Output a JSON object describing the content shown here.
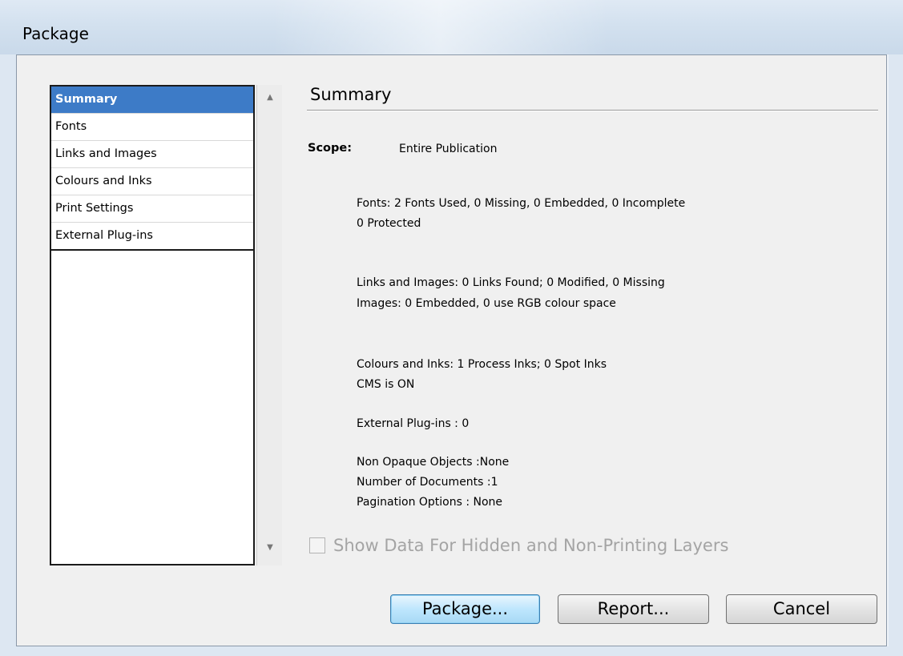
{
  "window": {
    "title": "Package"
  },
  "sidebar": {
    "items": [
      {
        "label": "Summary",
        "selected": true
      },
      {
        "label": "Fonts"
      },
      {
        "label": "Links and Images"
      },
      {
        "label": "Colours and Inks"
      },
      {
        "label": "Print Settings"
      },
      {
        "label": "External Plug-ins"
      }
    ],
    "scroll_up_icon": "triangle-up-icon",
    "scroll_down_icon": "triangle-down-icon"
  },
  "summary": {
    "title": "Summary",
    "scope_label": "Scope:",
    "scope_value": "Entire Publication",
    "fonts_line1": "Fonts: 2 Fonts Used, 0 Missing, 0 Embedded, 0 Incomplete",
    "fonts_line2": "0 Protected",
    "links_line1": "Links and Images: 0 Links Found; 0 Modified, 0 Missing",
    "links_line2": "Images: 0 Embedded, 0 use RGB colour space",
    "colours_line1": "Colours and Inks: 1 Process Inks; 0 Spot Inks",
    "colours_line2": "CMS is ON",
    "plugins_line": "External Plug-ins : 0",
    "non_opaque": "Non Opaque Objects :None",
    "num_documents": "Number of Documents :1",
    "pagination": "Pagination Options : None"
  },
  "options": {
    "show_hidden_label": "Show Data For Hidden and Non-Printing Layers",
    "show_hidden_checked": false,
    "show_hidden_enabled": false
  },
  "buttons": {
    "package": "Package...",
    "report": "Report...",
    "cancel": "Cancel"
  },
  "colors": {
    "selection": "#3d7bc7",
    "default_button": "#bee6fd",
    "disabled_text": "#a4a4a4"
  }
}
